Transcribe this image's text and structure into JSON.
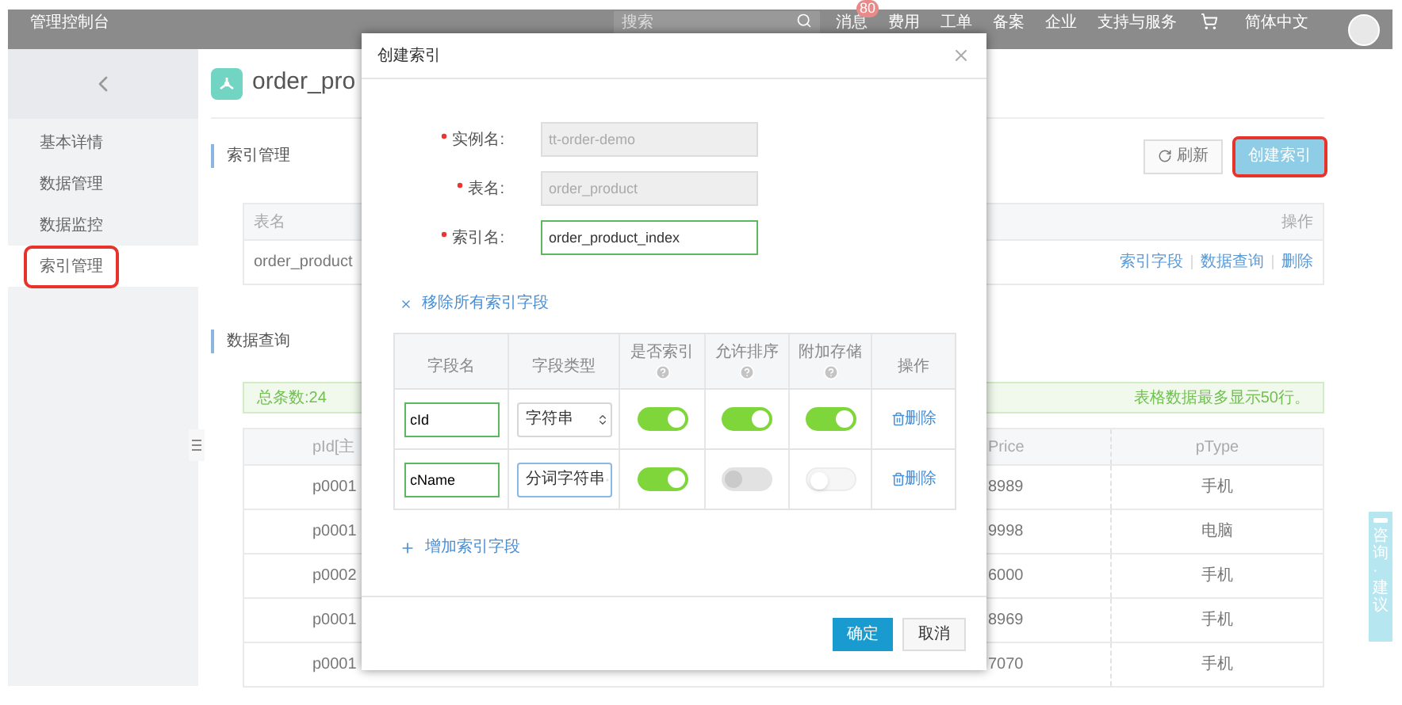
{
  "topbar": {
    "title": "管理控制台",
    "search": {
      "placeholder": "搜索"
    },
    "nav": [
      {
        "label": "消息",
        "badge": "80"
      },
      {
        "label": "费用"
      },
      {
        "label": "工单"
      },
      {
        "label": "备案"
      },
      {
        "label": "企业"
      },
      {
        "label": "支持与服务"
      }
    ],
    "language": "简体中文"
  },
  "sidebar": {
    "items": [
      {
        "label": "基本详情",
        "selected": false,
        "highlighted": false
      },
      {
        "label": "数据管理",
        "selected": false,
        "highlighted": false
      },
      {
        "label": "数据监控",
        "selected": false,
        "highlighted": false
      },
      {
        "label": "索引管理",
        "selected": true,
        "highlighted": true
      }
    ]
  },
  "page": {
    "title": "order_pro",
    "index_section": {
      "heading": "索引管理",
      "buttons": [
        {
          "label": "刷新",
          "kind": "refresh",
          "highlighted": false
        },
        {
          "label": "创建索引",
          "kind": "primary",
          "highlighted": true
        }
      ],
      "columns": [
        "表名",
        "操作"
      ],
      "rows": [
        {
          "name": "order_product",
          "actions": [
            "索引字段",
            "数据查询",
            "删除"
          ]
        }
      ]
    },
    "query_section": {
      "heading": "数据查询",
      "total": "总条数:24",
      "notice": "表格数据最多显示50行。",
      "columns": [
        "pId[主",
        "Price",
        "pType"
      ],
      "rows": [
        [
          "p0001",
          "8989",
          "手机"
        ],
        [
          "p0001",
          "9998",
          "电脑"
        ],
        [
          "p0002",
          "6000",
          "手机"
        ],
        [
          "p0001",
          "8969",
          "手机"
        ],
        [
          "p0001",
          "7070",
          "手机"
        ]
      ]
    }
  },
  "feedback_tab": "咨询·建议",
  "dialog": {
    "title": "创建索引",
    "fields": [
      {
        "label": "实例名:",
        "value": "tt-order-demo",
        "required": true,
        "disabled": true
      },
      {
        "label": "表名:",
        "value": "order_product",
        "required": true,
        "disabled": true
      },
      {
        "label": "索引名:",
        "value": "order_product_index",
        "required": true,
        "disabled": false
      }
    ],
    "remove_all": "移除所有索引字段",
    "columns": [
      {
        "label": "字段名",
        "help": false
      },
      {
        "label": "字段类型",
        "help": false
      },
      {
        "label": "是否索引",
        "help": true
      },
      {
        "label": "允许排序",
        "help": true
      },
      {
        "label": "附加存储",
        "help": true
      },
      {
        "label": "操作",
        "help": false
      }
    ],
    "rows": [
      {
        "name": "cId",
        "type": "字符串",
        "type_focused": false,
        "indexed": {
          "on": true,
          "disabled": false
        },
        "sortable": {
          "on": true,
          "disabled": false
        },
        "stored": {
          "on": true,
          "disabled": false
        },
        "action": "删除"
      },
      {
        "name": "cName",
        "type": "分词字符串",
        "type_focused": true,
        "indexed": {
          "on": true,
          "disabled": false
        },
        "sortable": {
          "on": false,
          "disabled": true
        },
        "stored": {
          "on": false,
          "disabled": false
        },
        "action": "删除"
      }
    ],
    "add": "增加索引字段",
    "buttons": [
      {
        "label": "确定",
        "kind": "primary"
      },
      {
        "label": "取消",
        "kind": "default"
      }
    ]
  }
}
